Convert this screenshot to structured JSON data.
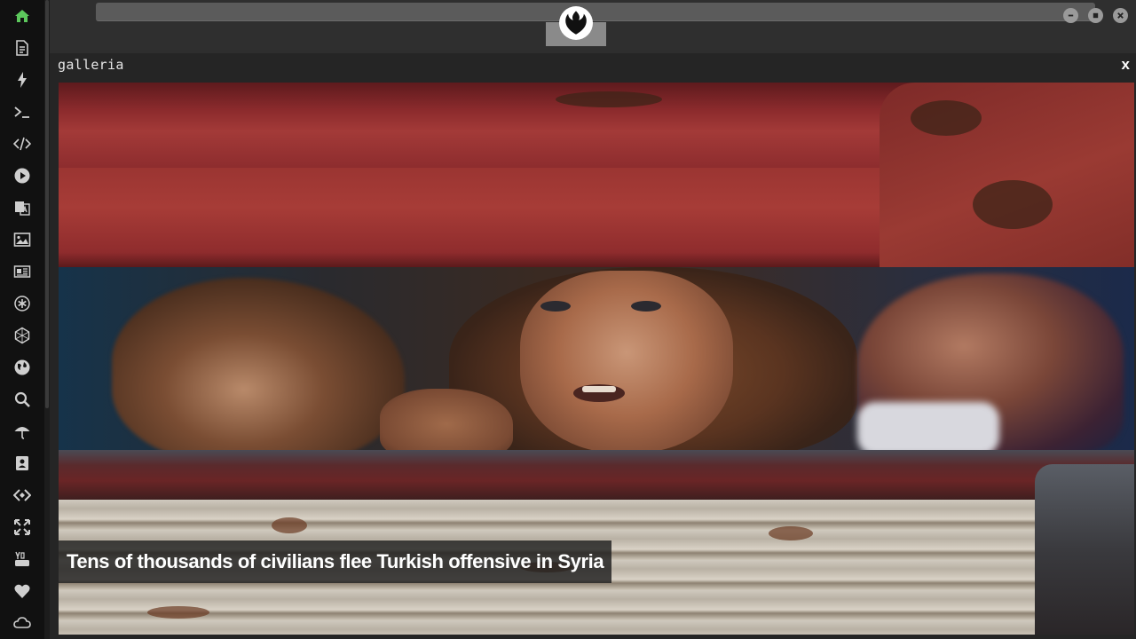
{
  "dock": {
    "items": [
      {
        "icon": "home-icon",
        "color": "#5cc85c",
        "active": true
      },
      {
        "icon": "document-icon"
      },
      {
        "icon": "lightning-icon"
      },
      {
        "icon": "terminal-icon"
      },
      {
        "icon": "code-icon"
      },
      {
        "icon": "play-icon"
      },
      {
        "icon": "translate-icon"
      },
      {
        "icon": "image-icon"
      },
      {
        "icon": "newspaper-icon"
      },
      {
        "icon": "asterisk-icon"
      },
      {
        "icon": "hexagon-icon"
      },
      {
        "icon": "globe-icon"
      },
      {
        "icon": "search-icon"
      },
      {
        "icon": "umbrella-icon"
      },
      {
        "icon": "contact-card-icon"
      },
      {
        "icon": "source-code-icon"
      },
      {
        "icon": "expand-icon"
      },
      {
        "icon": "youtube-icon"
      },
      {
        "icon": "heart-icon"
      },
      {
        "icon": "cloud-icon"
      }
    ]
  },
  "topbar": {
    "logo_icon": "rebel-alliance-icon",
    "window_buttons": [
      "minimize-icon",
      "maximize-icon",
      "close-icon"
    ]
  },
  "window": {
    "title": "galleria",
    "close_label": "x"
  },
  "gallery": {
    "caption": "Tens of thousands of civilians flee Turkish offensive in Syria"
  },
  "colors": {
    "dock_bg": "#111111",
    "accent_home": "#5cc85c",
    "window_bg": "#252525",
    "caption_bg": "#1e1e1e"
  }
}
